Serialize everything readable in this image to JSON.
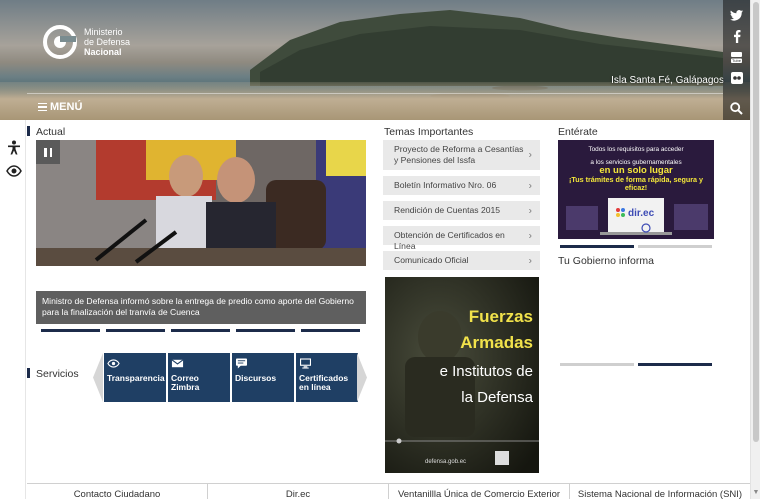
{
  "header": {
    "logo_line1": "Ministerio",
    "logo_line2": "de Defensa",
    "logo_line3": "Nacional",
    "photo_caption": "Isla Santa Fé, Galápagos",
    "menu_label": "MENÚ"
  },
  "social": [
    {
      "icon": "twitter-icon"
    },
    {
      "icon": "facebook-icon"
    },
    {
      "icon": "youtube-icon"
    },
    {
      "icon": "flickr-icon"
    }
  ],
  "actual": {
    "title": "Actual",
    "caption": "Ministro de Defensa informó sobre la entrega de predio como aporte del Gobierno para la finalización del tranvía de Cuenca",
    "slides": 5
  },
  "servicios": {
    "title": "Servicios",
    "items": [
      {
        "label": "Transparencia",
        "icon": "eye-icon"
      },
      {
        "label": "Correo Zimbra",
        "icon": "mail-icon"
      },
      {
        "label": "Discursos",
        "icon": "speech-icon"
      },
      {
        "label": "Certificados en línea",
        "icon": "monitor-icon"
      }
    ]
  },
  "temas": {
    "title": "Temas Importantes",
    "items": [
      "Proyecto de Reforma a Cesantías y Pensiones del Issfa",
      "Boletín Informativo Nro. 06",
      "Rendición de Cuentas 2015",
      "Obtención de Certificados en Línea",
      "Comunicado Oficial"
    ],
    "poster": {
      "line1": "Fuerzas",
      "line2": "Armadas",
      "line3": "e Institutos de",
      "line4": "la Defensa",
      "website": "defensa.gob.ec"
    }
  },
  "enterate": {
    "title": "Entérate",
    "banner_line1": "Todos los requisitos para acceder",
    "banner_line2": "a los servicios gubernamentales",
    "banner_line3": "en un solo lugar",
    "banner_line4": "¡Tus trámites de forma rápida, segura y eficaz!",
    "banner_brand": "dir.ec",
    "gobierno_title": "Tu Gobierno informa"
  },
  "footer": {
    "items": [
      "Contacto Ciudadano",
      "Dir.ec",
      "Ventanillla Única de Comercio Exterior",
      "Sistema Nacional de Información (SNI)"
    ]
  },
  "colors": {
    "navy": "#1c2b4a",
    "service_blue": "#1f3f64",
    "tema_bg": "#e9e9e9",
    "caption_bg": "#5f5f5f"
  }
}
